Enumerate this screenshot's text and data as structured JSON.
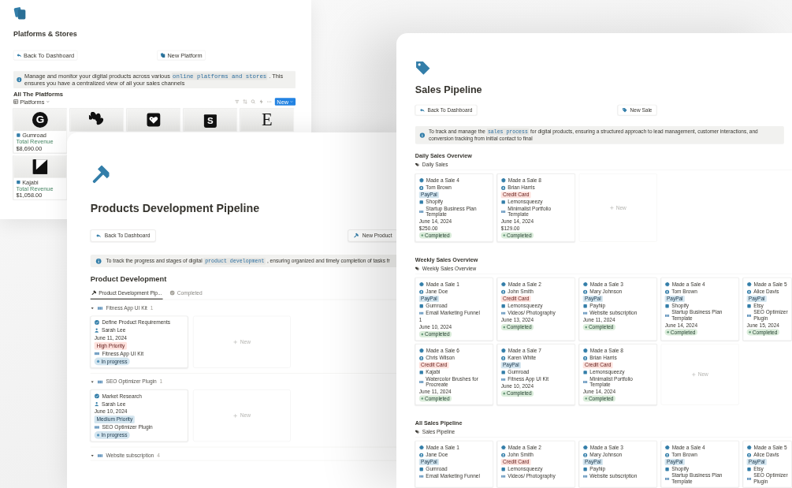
{
  "platforms_page": {
    "title": "Platforms & Stores",
    "buttons": [
      {
        "label": "Back To Dashboard"
      },
      {
        "label": "New Platform"
      }
    ],
    "callout": {
      "before": "Manage and monitor your digital products across various ",
      "code": "online platforms and stores",
      "after": " . This ensures you have a centralized view of all your sales channels"
    },
    "heading": "All The Platforms",
    "view": "Platforms",
    "new_button": "New",
    "platforms": [
      {
        "kind": "circle-letter",
        "letter": "G",
        "name": "Gumroad",
        "revenue_label": "Total Revenue",
        "revenue": "$8,690.00"
      },
      {
        "kind": "petals"
      },
      {
        "kind": "heart-square"
      },
      {
        "kind": "bag",
        "letter": "S"
      },
      {
        "kind": "serif-letter",
        "letter": "E"
      },
      {
        "kind": "k-mark",
        "name": "Kajabi",
        "revenue_label": "Total Revenue",
        "revenue": "$1,058.00"
      }
    ]
  },
  "products_page": {
    "title": "Products Development Pipeline",
    "buttons": [
      {
        "label": "Back To Dashboard"
      },
      {
        "label": "New Product"
      }
    ],
    "callout": {
      "before": "To track the progress and stages of digital ",
      "code": "product development",
      "after": " , ensuring organized and timely completion of tasks fr"
    },
    "heading": "Product Development",
    "tabs": [
      {
        "label": "Product Development Pip...",
        "selected": true
      },
      {
        "label": "Completed",
        "selected": false
      }
    ],
    "groups": [
      {
        "name": "Fitness App UI Kit",
        "count": "1",
        "expanded": true,
        "new_card": "New",
        "cards": [
          {
            "title": "Define Product Requirements",
            "assignee": "Sarah Lee",
            "date": "June 11, 2024",
            "priority": {
              "label": "High Priority",
              "color": "#ffe2dd"
            },
            "product": "Fitness App UI Kit",
            "status": "In progress"
          }
        ]
      },
      {
        "name": "SEO Optimizer Plugin",
        "count": "1",
        "expanded": true,
        "new_card": "New",
        "cards": [
          {
            "title": "Market Research",
            "assignee": "Sarah Lee",
            "date": "June 10, 2024",
            "priority": {
              "label": "Medium Priority",
              "color": "#d3e5ef"
            },
            "product": "SEO Optimizer Plugin",
            "status": "In progress"
          }
        ]
      },
      {
        "name": "Website subscription",
        "count": "4",
        "expanded": true
      }
    ]
  },
  "sales_page": {
    "title": "Sales Pipeline",
    "buttons": [
      {
        "label": "Back To Dashboard"
      },
      {
        "label": "New Sale"
      }
    ],
    "callout": {
      "before": "To track and manage the ",
      "code": "sales process",
      "after": " for digital products, ensuring a structured approach to lead management, customer interactions, and conversion tracking from initial contact to final"
    },
    "sections": [
      {
        "heading": "Daily Sales Overview",
        "view": "Daily Sales",
        "new_card": "New",
        "cards": [
          {
            "title": "Made a Sale 4",
            "customer": "Tom Brown",
            "payment": {
              "label": "PayPal",
              "color": "#d3e5ef"
            },
            "platform": "Shopify",
            "product": "Startup Business Plan Template",
            "date": "June 14, 2024",
            "amount": "$250.00",
            "status": "Completed"
          },
          {
            "title": "Made a Sale 8",
            "customer": "Brian Harris",
            "payment": {
              "label": "Credit Card",
              "color": "#ffe2dd"
            },
            "platform": "Lemonsqueezy",
            "product": "Minimalist Portfolio Template",
            "date": "June 14, 2024",
            "amount": "$129.00",
            "status": "Completed"
          }
        ]
      },
      {
        "heading": "Weekly Sales Overview",
        "view": "Weekly Sales Overview",
        "new_card": "New",
        "cards": [
          {
            "title": "Made a Sale 1",
            "customer": "Jane Doe",
            "payment": {
              "label": "PayPal",
              "color": "#d3e5ef"
            },
            "platform": "Gumroad",
            "product": "Email Marketing Funnel",
            "note": "1",
            "date": "June 10, 2024",
            "status": "Completed"
          },
          {
            "title": "Made a Sale 2",
            "customer": "John Smith",
            "payment": {
              "label": "Credit Card",
              "color": "#ffe2dd"
            },
            "platform": "Lemonsqueezy",
            "product": "Videos/ Photography",
            "date": "June 13, 2024",
            "status": "Completed"
          },
          {
            "title": "Made a Sale 3",
            "customer": "Mary Johnson",
            "payment": {
              "label": "PayPal",
              "color": "#d3e5ef"
            },
            "platform": "Payhip",
            "product": "Website subscription",
            "date": "June 11, 2024",
            "status": "Completed"
          },
          {
            "title": "Made a Sale 4",
            "customer": "Tom Brown",
            "payment": {
              "label": "PayPal",
              "color": "#d3e5ef"
            },
            "platform": "Shopify",
            "product": "Startup Business Plan Template",
            "date": "June 14, 2024",
            "status": "Completed"
          },
          {
            "title": "Made a Sale 5",
            "customer": "Alice Davis",
            "payment": {
              "label": "PayPal",
              "color": "#d3e5ef"
            },
            "platform": "Etsy",
            "product": "SEO Optimizer Plugin",
            "date": "June 15, 2024",
            "status": "Completed"
          },
          {
            "title": "Made a Sale 6",
            "customer": "Chris Wilson",
            "payment": {
              "label": "Credit Card",
              "color": "#ffe2dd"
            },
            "platform": "Kajabi",
            "product": "Watercolor Brushes for Procreate",
            "date": "June 11, 2024",
            "status": "Completed"
          },
          {
            "title": "Made a Sale 7",
            "customer": "Karen White",
            "payment": {
              "label": "PayPal",
              "color": "#d3e5ef"
            },
            "platform": "Gumroad",
            "product": "Fitness App UI Kit",
            "date": "June 10, 2024",
            "status": "Completed"
          },
          {
            "title": "Made a Sale 8",
            "customer": "Brian Harris",
            "payment": {
              "label": "Credit Card",
              "color": "#ffe2dd"
            },
            "platform": "Lemonsqueezy",
            "product": "Minimalist Portfolio Template",
            "date": "June 14, 2024",
            "status": "Completed"
          }
        ]
      },
      {
        "heading": "All Sales Pipeline",
        "view": "Sales Pipeline",
        "cards": [
          {
            "title": "Made a Sale 1",
            "customer": "Jane Doe",
            "payment": {
              "label": "PayPal",
              "color": "#d3e5ef"
            },
            "platform": "Gumroad",
            "product": "Email Marketing Funnel"
          },
          {
            "title": "Made a Sale 2",
            "customer": "John Smith",
            "payment": {
              "label": "Credit Card",
              "color": "#ffe2dd"
            },
            "platform": "Lemonsqueezy",
            "product": "Videos/ Photography"
          },
          {
            "title": "Made a Sale 3",
            "customer": "Mary Johnson",
            "payment": {
              "label": "PayPal",
              "color": "#d3e5ef"
            },
            "platform": "Payhip",
            "product": "Website subscription"
          },
          {
            "title": "Made a Sale 4",
            "customer": "Tom Brown",
            "payment": {
              "label": "PayPal",
              "color": "#d3e5ef"
            },
            "platform": "Shopify",
            "product": "Startup Business Plan Template"
          },
          {
            "title": "Made a Sale 5",
            "customer": "Alice Davis",
            "payment": {
              "label": "PayPal",
              "color": "#d3e5ef"
            },
            "platform": "Etsy",
            "product": "SEO Optimizer Plugin"
          }
        ]
      }
    ]
  }
}
